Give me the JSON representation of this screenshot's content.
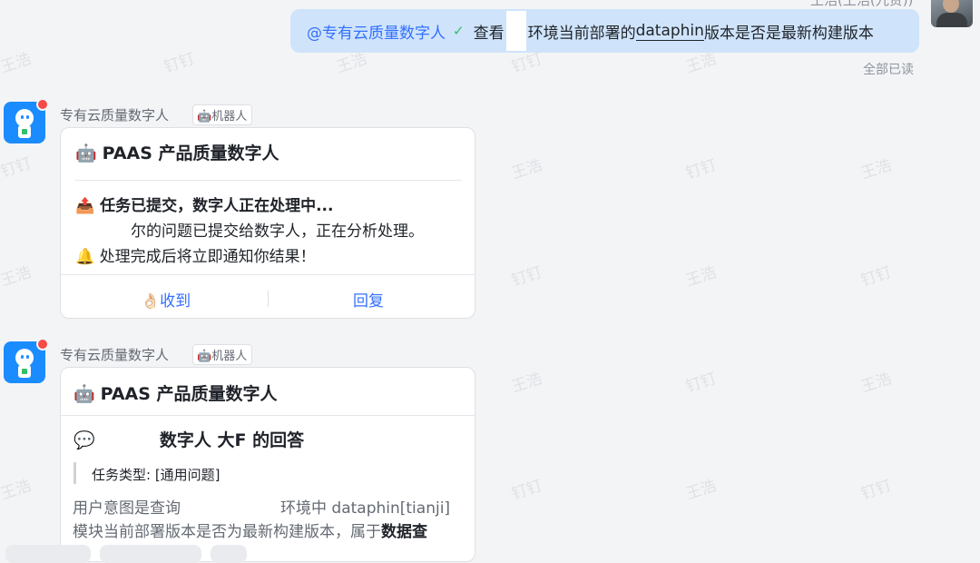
{
  "header_partial_name": "王浩(王浩(九贤))",
  "my_message": {
    "mention": "@专有云质量数字人",
    "text_before": "查看",
    "text_after_gap": "环境当前部署的",
    "underlined": "dataphin",
    "text_end": "版本是否是最新构建版本",
    "read_status": "全部已读"
  },
  "bot_messages": [
    {
      "sender": "专有云质量数字人",
      "tag": "机器人",
      "title_emoji": "🤖",
      "title": "PAAS 产品质量数字人",
      "lines": [
        {
          "emoji": "📤",
          "text": "任务已提交，数字人正在处理中..."
        },
        {
          "emoji": "",
          "text": "尔的问题已提交给数字人，正在分析处理。"
        },
        {
          "emoji": "🔔",
          "text": "处理完成后将立即通知你结果！"
        }
      ],
      "actions": [
        {
          "emoji": "👌🏻",
          "label": "收到"
        },
        {
          "emoji": "",
          "label": "回复"
        }
      ]
    },
    {
      "sender": "专有云质量数字人",
      "tag": "机器人",
      "title_emoji": "🤖",
      "title": "PAAS 产品质量数字人",
      "answer_emoji": "💬",
      "answer_heading": "数字人 大F 的回答",
      "task_type": "任务类型: [通用问题]",
      "intent_line1": "用户意图是查询",
      "intent_line1_tail": "环境中 dataphin[tianji]",
      "intent_line2": "模块当前部署版本是否为最新构建版本，属于",
      "intent_line2_bold": "数据查"
    }
  ],
  "watermarks": [
    "王浩",
    "钉钉"
  ],
  "icons": {
    "check": "check-circle-icon",
    "robot": "robot-icon"
  }
}
